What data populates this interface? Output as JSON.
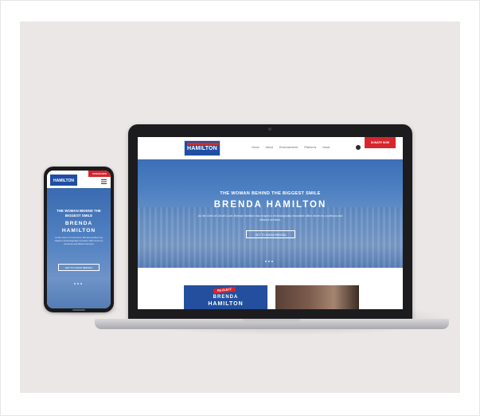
{
  "colors": {
    "brand_blue": "#1f4ea3",
    "donate_red": "#d7262d",
    "hero_blue": "#4d80c2",
    "backdrop": "#ebe7e6"
  },
  "desktop_site": {
    "logo_text": "HAMILTON",
    "nav_items": [
      "Home",
      "About",
      "Endorsements",
      "Platforms",
      "News"
    ],
    "facebook_icon": "facebook-icon",
    "donate_label": "DONATE NOW",
    "hero": {
      "kicker": "THE WOMAN BEHIND THE BIGGEST SMILE",
      "name": "BRENDA HAMILTON",
      "description": "As the Clerk of Circuit Court, Brenda Hamilton has shaped a technologically innovative office driven by courteous and efficient services.",
      "button_label": "GET TO KNOW BRENDA",
      "slide_count": 3
    },
    "card_badge": "RE-ELECT",
    "card_name_line1": "BRENDA",
    "card_name_line2": "HAMILTON"
  },
  "mobile_site": {
    "logo_text": "HAMILTON",
    "donate_label": "DONATE NOW",
    "menu_icon": "hamburger-icon",
    "hero": {
      "kicker": "THE WOMAN BEHIND THE BIGGEST SMILE",
      "name_line1": "BRENDA",
      "name_line2": "HAMILTON",
      "description": "As the Clerk of Circuit Court, Brenda Hamilton has shaped a technologically innovative office driven by courteous and efficient services.",
      "button_label": "GET TO KNOW BRENDA",
      "slide_count": 3
    }
  }
}
